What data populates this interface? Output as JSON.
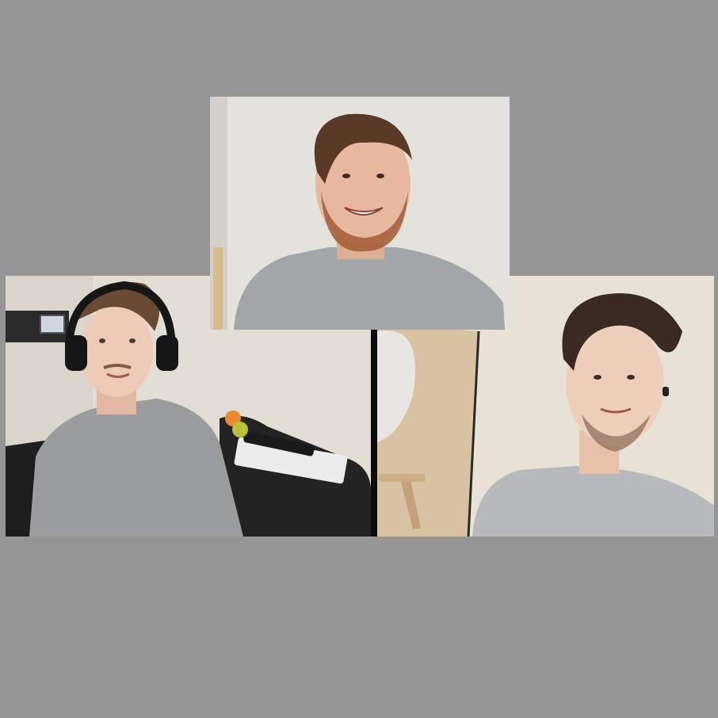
{
  "call": {
    "participants": [
      {
        "tile": "top",
        "label": "",
        "video": "on",
        "shirt_color": "#a3a6a8",
        "background_color": "#e4e2dd"
      },
      {
        "tile": "left",
        "label": "",
        "video": "on",
        "shirt_color": "#9a9c9d",
        "background_color": "#e2ded6",
        "accessory": "headphones-icon"
      },
      {
        "tile": "right",
        "label": "",
        "video": "on",
        "shirt_color": "#b7babc",
        "background_color": "#e8e2d6"
      }
    ]
  },
  "colors": {
    "page_background": "#959595",
    "divider": "#0d0d0d"
  }
}
